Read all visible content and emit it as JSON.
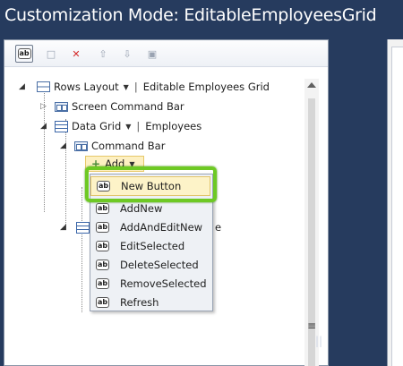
{
  "window": {
    "title": "Customization Mode: EditableEmployeesGrid"
  },
  "toolbar": {
    "add_icon_label": "ab",
    "buttons": [
      "add-item-icon",
      "add-group-icon",
      "delete-icon",
      "move-up-icon",
      "move-down-icon",
      "properties-icon"
    ]
  },
  "tree": {
    "rows_layout": {
      "label": "Rows Layout",
      "value": "Editable Employees Grid"
    },
    "screen_command_bar": {
      "label": "Screen Command Bar"
    },
    "data_grid": {
      "label": "Data Grid",
      "value": "Employees"
    },
    "command_bar": {
      "label": "Command Bar"
    },
    "add": {
      "label": "Add"
    },
    "partial_node": {
      "label": "e"
    }
  },
  "menu": {
    "icon_label": "ab",
    "items": [
      {
        "label": "New Button"
      },
      {
        "label": "AddNew"
      },
      {
        "label": "AddAndEditNew"
      },
      {
        "label": "EditSelected"
      },
      {
        "label": "DeleteSelected"
      },
      {
        "label": "RemoveSelected"
      },
      {
        "label": "Refresh"
      }
    ]
  },
  "colors": {
    "background": "#263b5e",
    "highlight_border": "#6ec924",
    "hover_fill": "#fdf3c8"
  }
}
